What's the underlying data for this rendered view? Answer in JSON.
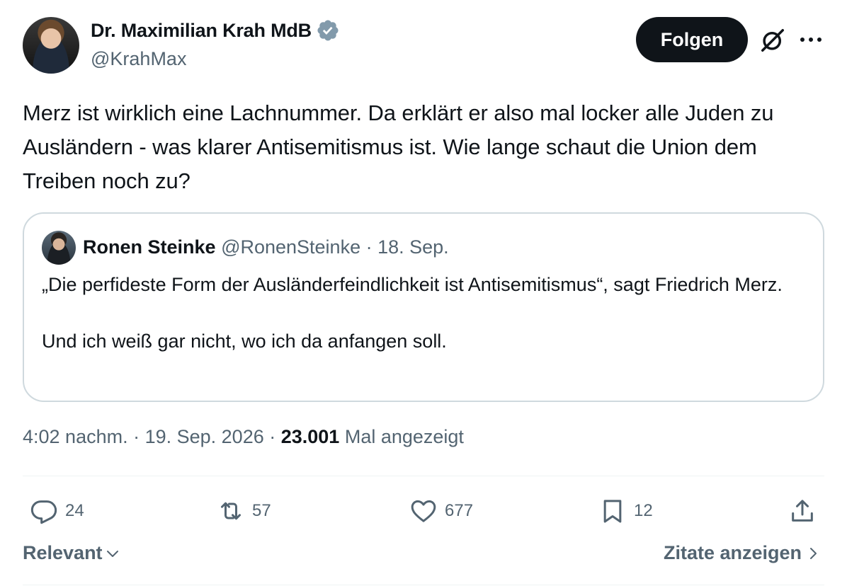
{
  "author": {
    "name": "Dr. Maximilian Krah MdB",
    "handle": "@KrahMax",
    "verified_icon": "verified-badge-icon"
  },
  "header": {
    "follow_label": "Folgen",
    "grok_icon": "grok-icon",
    "more_icon": "more-horizontal-icon"
  },
  "tweet": {
    "text": "Merz ist wirklich eine Lachnummer. Da erklärt er also mal locker alle Juden zu Ausländern - was klarer Antisemitismus ist. Wie lange schaut die Union dem Treiben noch zu?"
  },
  "quote": {
    "author": "Ronen Steinke",
    "meta": "@RonenSteinke · 18. Sep.",
    "paragraph1": "„Die perfideste Form der Ausländerfeindlichkeit ist Antisemitismus“, sagt Friedrich Merz.",
    "paragraph2": "Und ich weiß gar nicht, wo ich da anfangen soll."
  },
  "meta": {
    "time_date": "4:02 nachm. · 19. Sep. 2026 · ",
    "views_count": "23.001",
    "views_label": " Mal angezeigt"
  },
  "actions": {
    "replies": "24",
    "reposts": "57",
    "likes": "677",
    "bookmarks": "12"
  },
  "footer": {
    "sort_label": "Relevant",
    "quotes_label": "Zitate anzeigen"
  },
  "colors": {
    "text": "#0f1419",
    "secondary": "#536471",
    "border": "#cfd9de",
    "verified": "#829aab"
  }
}
